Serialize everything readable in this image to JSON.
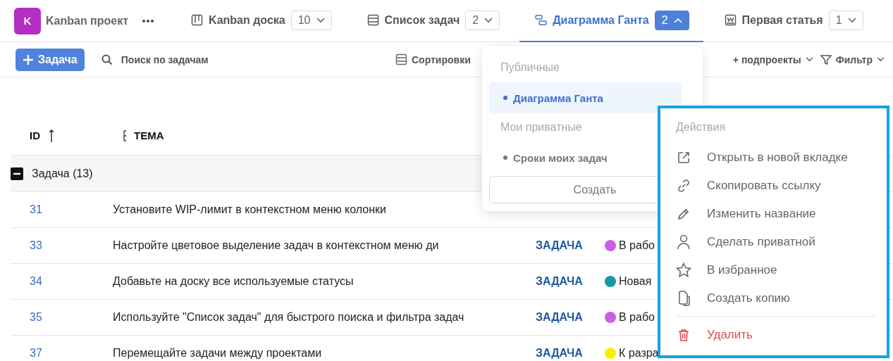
{
  "project": {
    "initial": "K",
    "name": "Kanban проект"
  },
  "tabs": [
    {
      "label": "Kanban доска",
      "count": "10",
      "selected": false,
      "expanded": false
    },
    {
      "label": "Список задач",
      "count": "2",
      "selected": false,
      "expanded": false
    },
    {
      "label": "Диаграмма Ганта",
      "count": "2",
      "selected": true,
      "expanded": true
    },
    {
      "label": "Первая статья",
      "count": "1",
      "selected": false,
      "expanded": false
    }
  ],
  "toolbar": {
    "add_button": "Задача",
    "search": {
      "placeholder": "Поиск по задачам"
    },
    "sort": "Сортировки",
    "subprojects": "+ подпроекты",
    "filter": "Фильтр"
  },
  "table": {
    "columns": [
      {
        "label": "ID",
        "sorted": true
      },
      {
        "label": "ТЕМА",
        "sorted": false
      }
    ],
    "group": {
      "label": "Задача (13)",
      "expanded": true
    },
    "rows": [
      {
        "id": "31",
        "subject": "Установите WIP-лимит в контекстном меню колонки"
      },
      {
        "id": "33",
        "subject": "Настройте цветовое выделение задач в контекстном меню ди",
        "type": "ЗАДАЧА",
        "status": "В рабо",
        "color": "#cc5de8"
      },
      {
        "id": "34",
        "subject": "Добавьте на доску все используемые статусы",
        "type": "ЗАДАЧА",
        "status": "Новая",
        "color": "#1a96a8"
      },
      {
        "id": "35",
        "subject": "Используйте \"Список задач\" для быстрого поиска и фильтра задач",
        "type": "ЗАДАЧА",
        "status": "В рабо",
        "color": "#cc5de8"
      },
      {
        "id": "37",
        "subject": "Перемещайте задачи между проектами",
        "type": "ЗАДАЧА",
        "status": "К разра",
        "color": "#f5f000"
      }
    ]
  },
  "views_dropdown": {
    "sections": [
      {
        "title": "Публичные",
        "items": [
          {
            "label": "Диаграмма Ганта",
            "selected": true
          }
        ]
      },
      {
        "title": "Мои приватные",
        "items": [
          {
            "label": "Сроки моих задач",
            "selected": false
          }
        ]
      }
    ],
    "create_button": "Создать"
  },
  "actions_menu": {
    "title": "Действия",
    "items": [
      {
        "label": "Открыть в новой вкладке",
        "kind": "action"
      },
      {
        "label": "Скопировать ссылку",
        "kind": "action"
      },
      {
        "label": "Изменить название",
        "kind": "action"
      },
      {
        "label": "Сделать приватной",
        "kind": "action"
      },
      {
        "label": "В избранное",
        "kind": "action"
      },
      {
        "label": "Создать копию",
        "kind": "action"
      },
      {
        "label": "Удалить",
        "kind": "danger"
      }
    ]
  }
}
